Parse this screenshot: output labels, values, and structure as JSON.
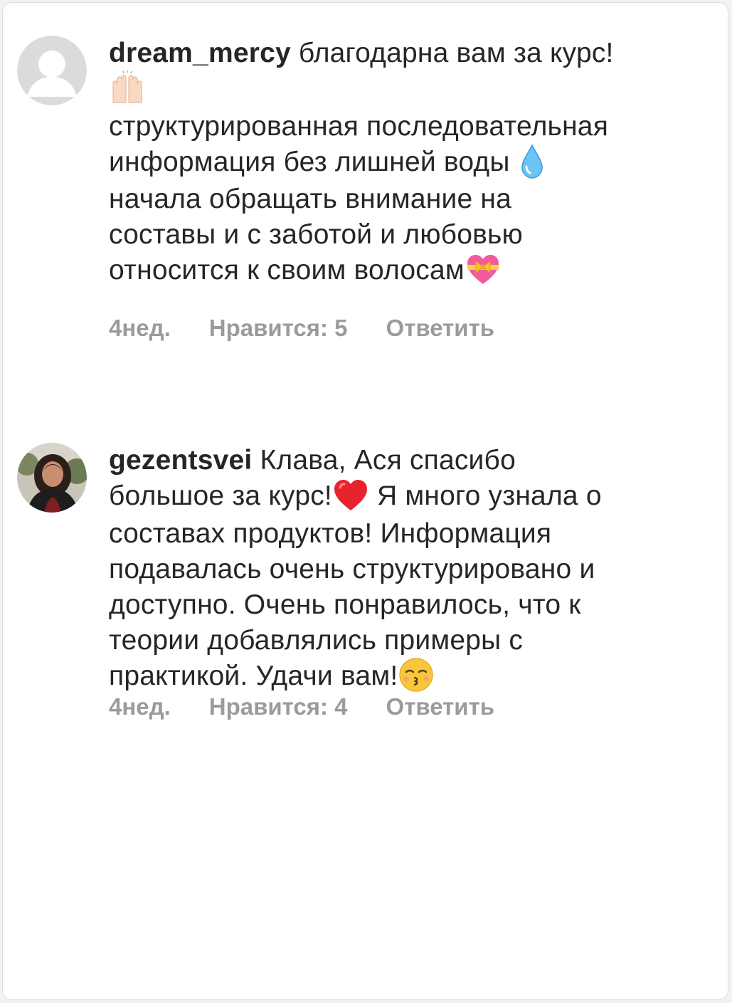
{
  "comments": [
    {
      "username": "dream_mercy",
      "lines": [
        "благодарна вам за курс!",
        "",
        "структурированная последовательная",
        "информация без лишней воды",
        "начала обращать внимание на",
        "составы и с заботой и любовью",
        "относится к своим волосам"
      ],
      "emojis": [
        "raising-hands-emoji",
        "droplet-emoji",
        "heart-with-ribbon-emoji"
      ],
      "time": "4нед.",
      "likes": "Нравится: 5",
      "reply": "Ответить"
    },
    {
      "username": "gezentsvei",
      "lines": [
        "Клава, Ася спасибо",
        "большое за курс!",
        "Я много узнала о",
        "составах продуктов! Информация",
        "подавалась очень структурировано и",
        "доступно. Очень понравилось, что к",
        "теории добавлялись примеры с",
        "практикой. Удачи вам!"
      ],
      "emojis": [
        "red-heart-emoji",
        "kissing-face-emoji"
      ],
      "time": "4нед.",
      "likes": "Нравится: 4",
      "reply": "Ответить"
    }
  ],
  "colors": {
    "text": "#262626",
    "meta": "#9b9b9b",
    "heart": "#e0245e"
  }
}
